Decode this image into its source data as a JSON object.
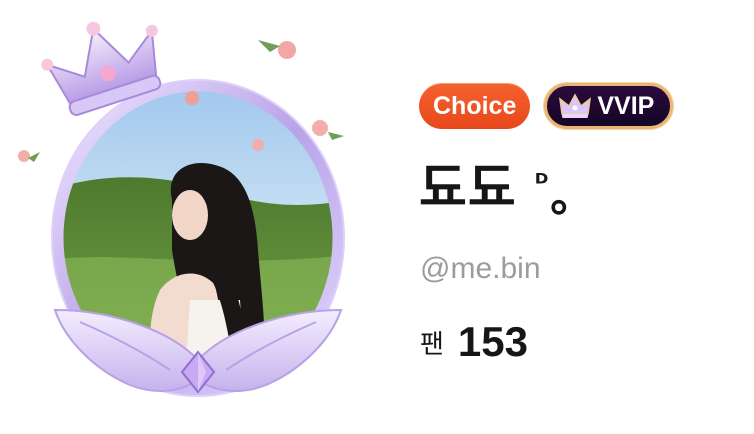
{
  "profile": {
    "badges": {
      "choice_label": "Choice",
      "vvip_label": "VVIP",
      "vvip_icon": "crown-icon"
    },
    "display_name": {
      "main": "됴됴",
      "superscript": "ᴰ",
      "suffix": "。"
    },
    "handle": "@me.bin",
    "fans": {
      "label": "팬",
      "count": "153"
    },
    "avatar": {
      "frame_icon": "crown-wings-frame",
      "decorations": [
        "crown-icon",
        "rose-icon",
        "wings-icon",
        "gem-icon"
      ]
    }
  },
  "colors": {
    "choice_badge": "#e8471b",
    "vvip_badge_bg": "#150526",
    "vvip_badge_border": "#e9b574",
    "name_text": "#161616",
    "handle_text": "#9c9c9c",
    "frame_lavender": "#c9b6ee"
  }
}
